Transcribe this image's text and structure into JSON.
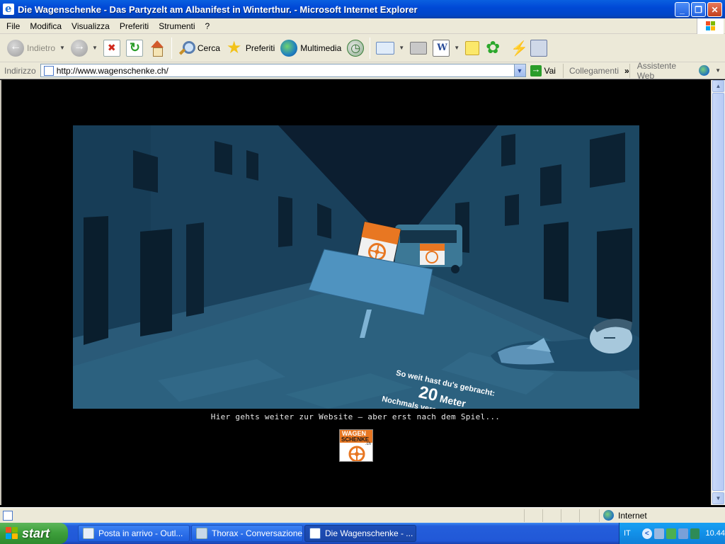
{
  "window": {
    "title": "Die Wagenschenke - Das Partyzelt am Albanifest in Winterthur. - Microsoft Internet Explorer",
    "min_label": "_",
    "max_label": "❐",
    "close_label": "✕"
  },
  "menu": {
    "items": [
      "File",
      "Modifica",
      "Visualizza",
      "Preferiti",
      "Strumenti",
      "?"
    ]
  },
  "toolbar": {
    "back_label": "Indietro",
    "search_label": "Cerca",
    "favorites_label": "Preferiti",
    "media_label": "Multimedia"
  },
  "address": {
    "label": "Indirizzo",
    "url": "http://www.wagenschenke.ch/",
    "go_label": "Vai",
    "links_label": "Collegamenti",
    "links_chevron": "»",
    "assistant_label": "Assistente Web"
  },
  "page": {
    "sign": {
      "line1": "So weit hast du's gebracht:",
      "distance_number": "20",
      "distance_unit": "Meter",
      "line3": "Nochmals versuchen? Klick da!"
    },
    "logo_text": {
      "top": "WAGEN",
      "bottom": "SCHENKE",
      "suffix": ".ch"
    },
    "continue_hint": "Hier gehts weiter zur Website – aber erst nach dem Spiel..."
  },
  "status": {
    "zone_label": "Internet"
  },
  "taskbar": {
    "start_label": "start",
    "tasks": [
      {
        "label": "Posta in arrivo - Outl..."
      },
      {
        "label": "Thorax - Conversazione"
      },
      {
        "label": "Die Wagenschenke - ..."
      }
    ],
    "language": "IT",
    "clock": "10.44"
  },
  "colors": {
    "title_bar": "#0049d6",
    "chrome": "#ece9d8",
    "sign_bg": "#4f93c0",
    "logo_orange": "#e87722",
    "scene_blue": "#1f5372"
  }
}
